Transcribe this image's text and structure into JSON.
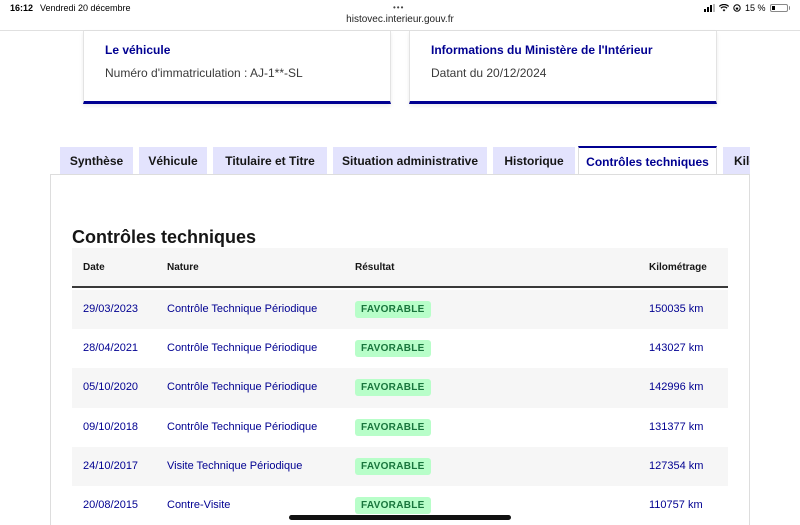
{
  "status_bar": {
    "time": "16:12",
    "date": "Vendredi 20 décembre",
    "battery": "15 %"
  },
  "browser": {
    "url": "histovec.interieur.gouv.fr"
  },
  "vehicle_card": {
    "title": "Le véhicule",
    "text": "Numéro d'immatriculation : AJ-1**-SL"
  },
  "ministry_card": {
    "title": "Informations du Ministère de l'Intérieur",
    "text": "Datant du 20/12/2024"
  },
  "tabs": [
    {
      "label": "Synthèse"
    },
    {
      "label": "Véhicule"
    },
    {
      "label": "Titulaire et Titre"
    },
    {
      "label": "Situation administrative"
    },
    {
      "label": "Historique"
    },
    {
      "label": "Contrôles techniques"
    },
    {
      "label": "Kilo"
    }
  ],
  "active_tab": "Contrôles techniques",
  "section": {
    "title": "Contrôles techniques"
  },
  "table": {
    "headers": {
      "date": "Date",
      "nature": "Nature",
      "result": "Résultat",
      "mileage": "Kilométrage"
    },
    "rows": [
      {
        "date": "29/03/2023",
        "nature": "Contrôle Technique Périodique",
        "result": "FAVORABLE",
        "mileage": "150035 km"
      },
      {
        "date": "28/04/2021",
        "nature": "Contrôle Technique Périodique",
        "result": "FAVORABLE",
        "mileage": "143027 km"
      },
      {
        "date": "05/10/2020",
        "nature": "Contrôle Technique Périodique",
        "result": "FAVORABLE",
        "mileage": "142996 km"
      },
      {
        "date": "09/10/2018",
        "nature": "Contrôle Technique Périodique",
        "result": "FAVORABLE",
        "mileage": "131377 km"
      },
      {
        "date": "24/10/2017",
        "nature": "Visite Technique Périodique",
        "result": "FAVORABLE",
        "mileage": "127354 km"
      },
      {
        "date": "20/08/2015",
        "nature": "Contre-Visite",
        "result": "FAVORABLE",
        "mileage": "110757 km"
      }
    ]
  },
  "colors": {
    "primary": "#000091",
    "tab_bg": "#e3e3fd",
    "badge_bg": "#b8fec9",
    "badge_text": "#18753c",
    "row_alt": "#f6f6f6"
  }
}
